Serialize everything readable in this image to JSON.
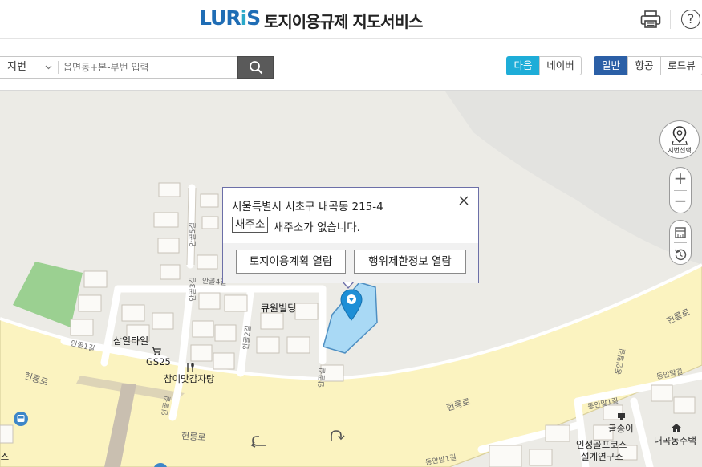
{
  "header": {
    "logo": "LURIS",
    "title": "토지이용규제 지도서비스",
    "print_icon": "printer-icon",
    "help_label": "?"
  },
  "toolbar": {
    "search_type": "지번",
    "search_placeholder": "읍면동+본-부번 입력",
    "search_icon": "search-icon",
    "provider_tabs": [
      "다음",
      "네이버"
    ],
    "map_type_tabs": [
      "일반",
      "항공",
      "로드뷰"
    ]
  },
  "popup": {
    "address": "서울특별시 서초구 내곡동 215-4",
    "new_addr_tag": "새주소",
    "new_addr_text": "새주소가 없습니다.",
    "button_plan": "토지이용계획 열람",
    "button_restriction": "행위제한정보 열람",
    "close_icon": "close-icon"
  },
  "map_controls": {
    "lot_select_label": "지번선택",
    "zoom_in": "+",
    "zoom_out": "−"
  },
  "map_labels": {
    "building_qwon": "큐원빌딩",
    "building_samil": "삼일타일",
    "store_gs25": "GS25",
    "restaurant": "참이맛감자탕",
    "road_heonneung_1": "헌릉로",
    "road_heonneung_2": "헌릉로",
    "road_heonneung_3": "헌릉로",
    "road_heonneung_4": "헌릉로",
    "road_heonneung_5": "헌릉로",
    "alley_angol1": "안골1길",
    "alley_angol2": "안골2길",
    "alley_angol3": "안골3길",
    "alley_angol4": "안골4길",
    "alley_angol5": "안골5길",
    "alley_angol6": "안골길",
    "alley_angol7": "안골길",
    "alley_dongan1": "동안말1길",
    "alley_dongan2": "동안말길",
    "alley_dongan3": "동안말길",
    "alley_dongan4": "동안말1길",
    "place_geulsong": "글송이",
    "place_golf": "인성골프코스",
    "place_design": "설계연구소",
    "place_naegok": "내곡동주택",
    "place_edge": "시스"
  },
  "colors": {
    "accent_daum": "#1eadd8",
    "accent_general": "#2b5fa6",
    "road_fill": "#fbf3c0",
    "parcel_fill": "#a9d9f5",
    "marker": "#1e8fd6"
  }
}
